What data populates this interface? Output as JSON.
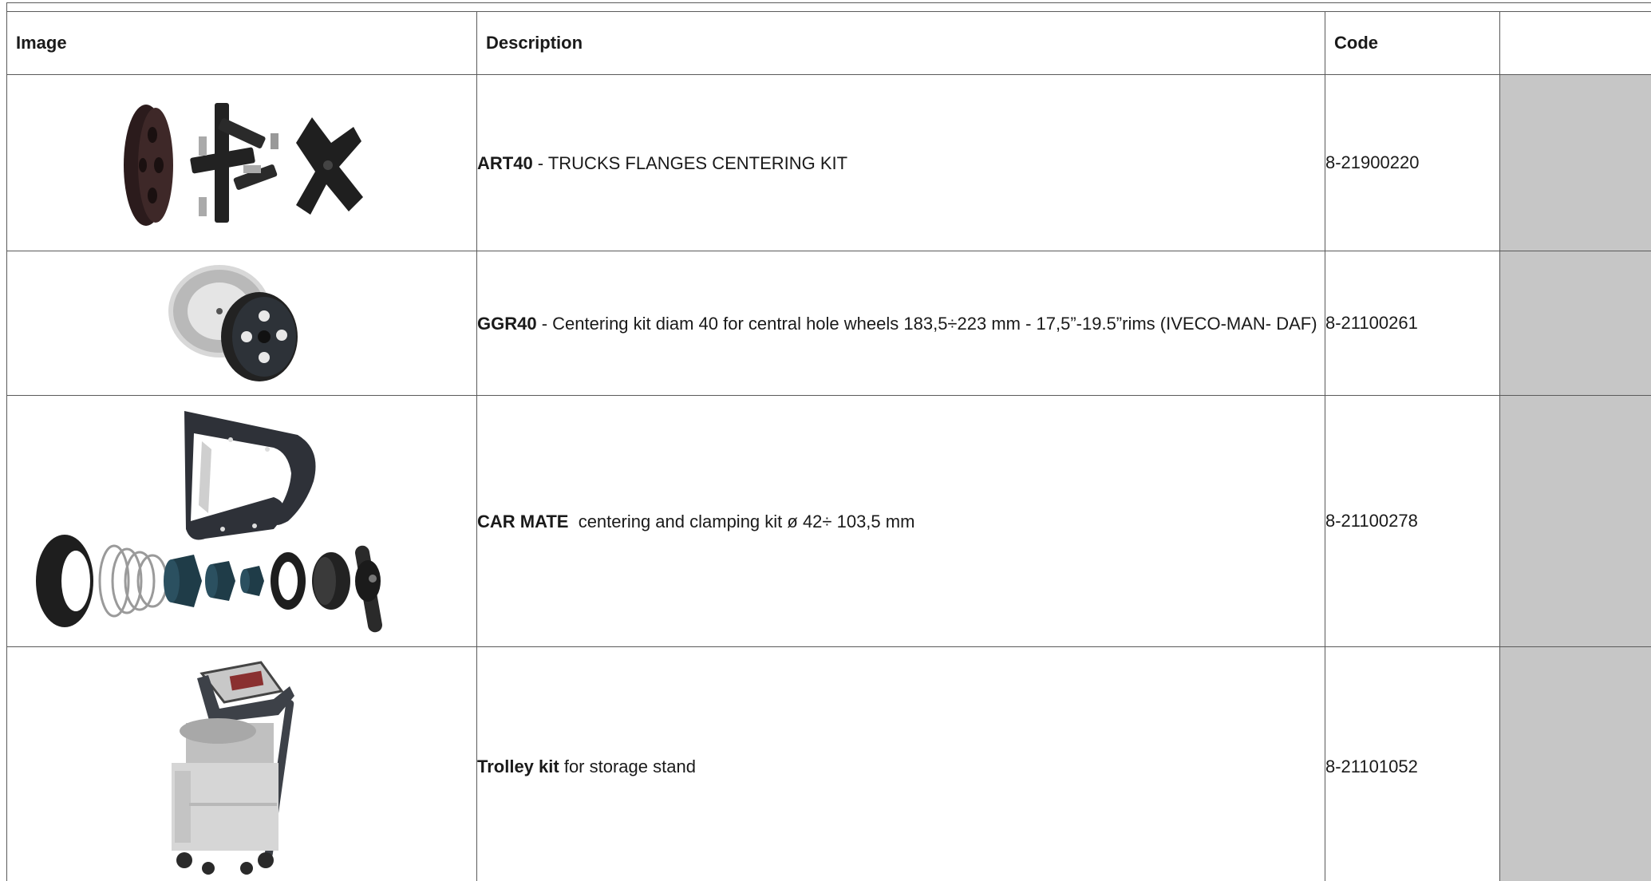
{
  "table": {
    "headers": {
      "image": "Image",
      "description": "Description",
      "code": "Code",
      "extra": ""
    },
    "rows": [
      {
        "name": "ART40",
        "description": " - TRUCKS FLANGES CENTERING KIT",
        "code": "8-21900220",
        "icon": "truck-flanges-kit-image"
      },
      {
        "name": "GGR40",
        "description": " - Centering kit diam 40 for central hole wheels 183,5÷223 mm - 17,5”-19.5”rims (IVECO-MAN- DAF)",
        "code": "8-21100261",
        "icon": "centering-cone-kit-image"
      },
      {
        "name": "CAR MATE",
        "description": "  centering and clamping kit ø 42÷ 103,5 mm",
        "code": "8-21100278",
        "icon": "clamping-kit-image"
      },
      {
        "name": "Trolley kit",
        "description": " for storage stand",
        "code": "8-21101052",
        "icon": "trolley-image"
      }
    ]
  },
  "colors": {
    "border": "#5a5a5a",
    "shaded_cell": "#c6c6c6"
  }
}
